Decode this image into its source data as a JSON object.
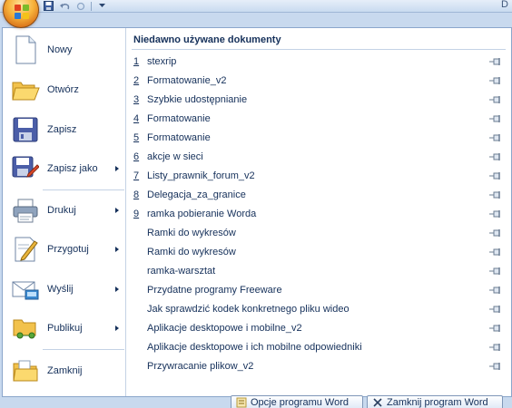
{
  "titlebar": {
    "title_letter": "D"
  },
  "left_menu": [
    {
      "label": "Nowy",
      "icon": "new-document-icon",
      "submenu": false
    },
    {
      "label": "Otwórz",
      "icon": "open-folder-icon",
      "submenu": false
    },
    {
      "label": "Zapisz",
      "icon": "save-disk-icon",
      "submenu": false
    },
    {
      "label": "Zapisz jako",
      "icon": "save-as-icon",
      "submenu": true
    },
    {
      "label": "Drukuj",
      "icon": "printer-icon",
      "submenu": true
    },
    {
      "label": "Przygotuj",
      "icon": "prepare-icon",
      "submenu": true
    },
    {
      "label": "Wyślij",
      "icon": "send-icon",
      "submenu": true
    },
    {
      "label": "Publikuj",
      "icon": "publish-icon",
      "submenu": true
    },
    {
      "label": "Zamknij",
      "icon": "close-folder-icon",
      "submenu": false
    }
  ],
  "recent": {
    "title": "Niedawno używane dokumenty",
    "items": [
      {
        "num": "1",
        "name": "stexrip"
      },
      {
        "num": "2",
        "name": "Formatowanie_v2"
      },
      {
        "num": "3",
        "name": "Szybkie udostępnianie"
      },
      {
        "num": "4",
        "name": "Formatowanie"
      },
      {
        "num": "5",
        "name": "Formatowanie"
      },
      {
        "num": "6",
        "name": "akcje w sieci"
      },
      {
        "num": "7",
        "name": "Listy_prawnik_forum_v2"
      },
      {
        "num": "8",
        "name": "Delegacja_za_granice"
      },
      {
        "num": "9",
        "name": "ramka pobieranie Worda"
      },
      {
        "num": "",
        "name": "Ramki do wykresów"
      },
      {
        "num": "",
        "name": "Ramki do wykresów"
      },
      {
        "num": "",
        "name": "ramka-warsztat"
      },
      {
        "num": "",
        "name": "Przydatne programy Freeware"
      },
      {
        "num": "",
        "name": "Jak sprawdzić kodek konkretnego pliku wideo"
      },
      {
        "num": "",
        "name": "Aplikacje desktopowe i mobilne_v2"
      },
      {
        "num": "",
        "name": "Aplikacje desktopowe i ich mobilne odpowiedniki"
      },
      {
        "num": "",
        "name": "Przywracanie plikow_v2"
      }
    ]
  },
  "buttons": {
    "options": "Opcje programu Word",
    "exit": "Zamknij program Word"
  },
  "colors": {
    "accent": "#15305a",
    "border": "#8ba6cb",
    "frame": "#c8d9ee"
  }
}
